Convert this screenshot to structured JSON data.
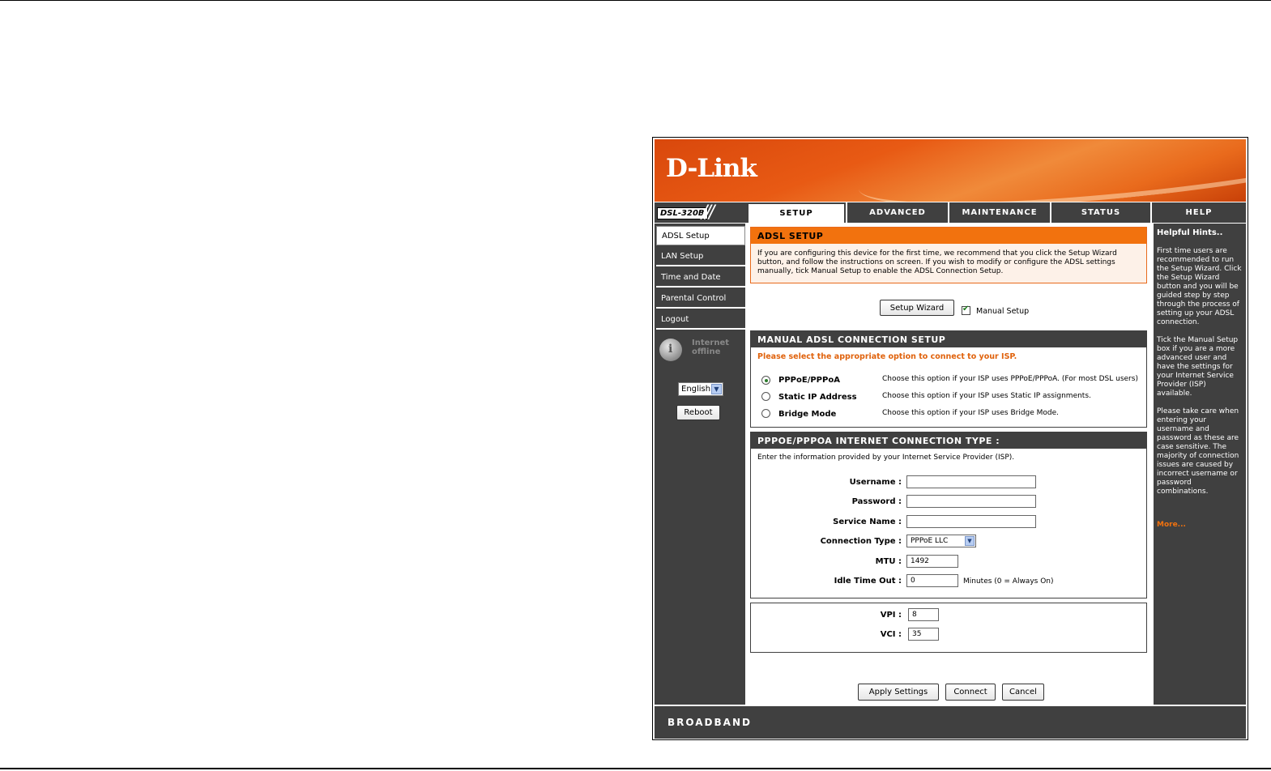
{
  "header": {
    "logo": "D-Link",
    "model": "DSL-320B",
    "tabs": [
      "SETUP",
      "ADVANCED",
      "MAINTENANCE",
      "STATUS",
      "HELP"
    ]
  },
  "sidebar": {
    "items": [
      "ADSL Setup",
      "LAN Setup",
      "Time and Date",
      "Parental Control",
      "Logout"
    ],
    "status_line1": "Internet",
    "status_line2": "offline",
    "language": "English",
    "reboot": "Reboot"
  },
  "adsl_setup": {
    "title": "ADSL SETUP",
    "intro": "If you are configuring this device for the first time, we recommend that you click the Setup Wizard button, and follow the instructions on screen. If you wish to modify or configure the ADSL settings manually, tick Manual Setup to enable the ADSL Connection Setup.",
    "wizard_button": "Setup Wizard",
    "manual_setup_label": "Manual Setup",
    "manual_setup_checked": true
  },
  "manual": {
    "title": "MANUAL ADSL CONNECTION SETUP",
    "note": "Please select the appropriate option to connect to your ISP.",
    "options": [
      {
        "label": "PPPoE/PPPoA",
        "desc": "Choose this option if your ISP uses PPPoE/PPPoA. (For most DSL users)",
        "selected": true
      },
      {
        "label": "Static IP Address",
        "desc": "Choose this option if your ISP uses Static IP assignments.",
        "selected": false
      },
      {
        "label": "Bridge Mode",
        "desc": "Choose this option if your ISP uses Bridge Mode.",
        "selected": false
      }
    ]
  },
  "pppoe": {
    "title": "PPPOE/PPPOA INTERNET CONNECTION TYPE :",
    "intro": "Enter the information provided by your Internet Service Provider (ISP).",
    "username_label": "Username :",
    "username": "",
    "password_label": "Password :",
    "password": "",
    "service_label": "Service Name :",
    "service": "",
    "conn_type_label": "Connection Type :",
    "conn_type": "PPPoE LLC",
    "mtu_label": "MTU :",
    "mtu": "1492",
    "idle_label": "Idle Time Out :",
    "idle": "0",
    "idle_hint": "Minutes (0 = Always On)"
  },
  "vc": {
    "vpi_label": "VPI :",
    "vpi": "8",
    "vci_label": "VCI :",
    "vci": "35"
  },
  "actions": {
    "apply": "Apply Settings",
    "connect": "Connect",
    "cancel": "Cancel"
  },
  "hints": {
    "title": "Helpful Hints..",
    "p1": "First time users are recommended to run the Setup Wizard. Click the Setup Wizard button and you will be guided step by step through the process of setting up your ADSL connection.",
    "p2": "Tick the Manual Setup box if you are a more advanced user and have the settings for your Internet Service Provider (ISP) available.",
    "p3": "Please take care when entering your username and password as these are case sensitive. The majority of connection issues are caused by incorrect username or password combinations.",
    "more": "More..."
  },
  "footer": {
    "brand": "BROADBAND"
  },
  "colors": {
    "accent": "#f2720e",
    "dark": "#404040"
  }
}
